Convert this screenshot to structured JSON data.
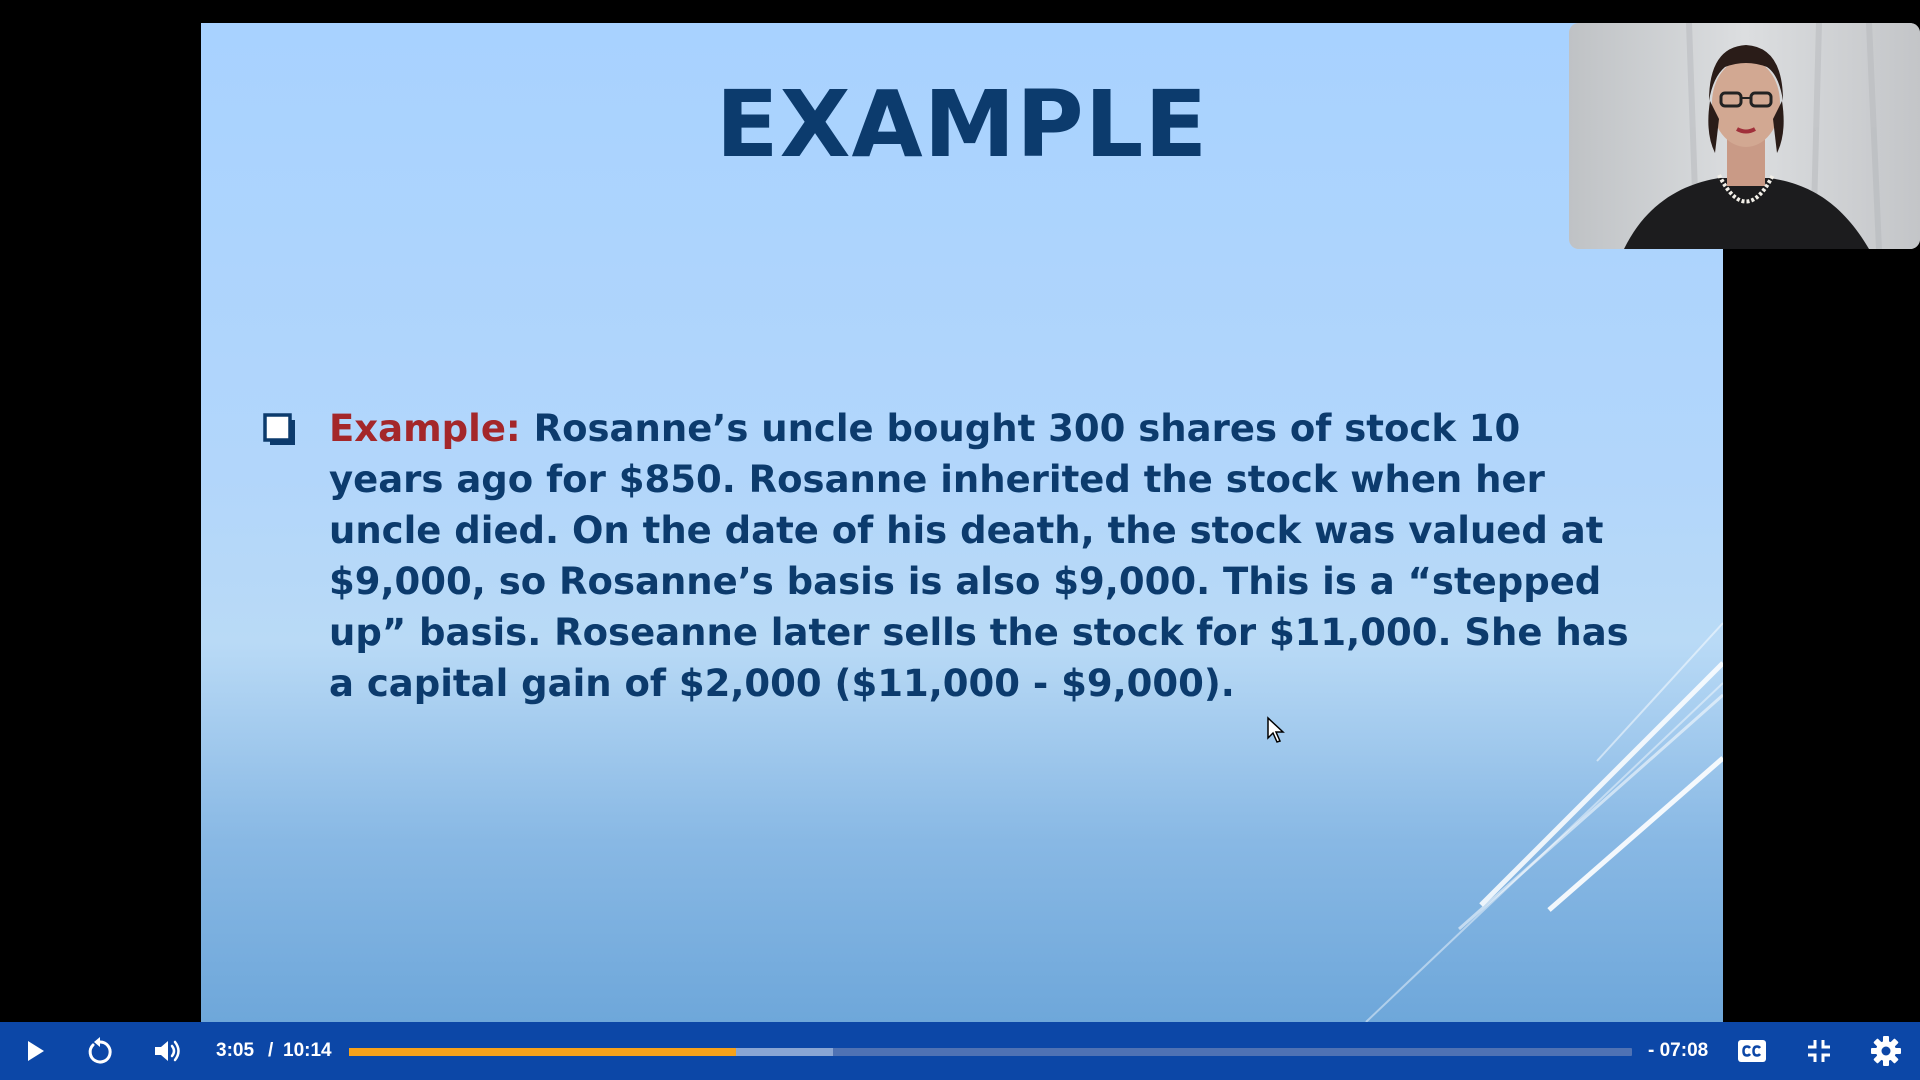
{
  "slide": {
    "title": "EXAMPLE",
    "bullet": {
      "lead": "Example:",
      "text": " Rosanne’s uncle bought 300 shares of stock 10 years ago for $850. Rosanne inherited the stock when her uncle died. On the date of his death, the stock was valued at $9,000, so Rosanne’s basis is also $9,000. This is a “stepped up” basis. Roseanne later sells the stock for $11,000. She has a capital gain of $2,000 ($11,000 - $9,000)."
    }
  },
  "player": {
    "time_current": "3:05",
    "time_separator": "/",
    "time_total": "10:14",
    "time_remaining": "- 07:08",
    "progress_fraction": 0.3014,
    "buffered_fraction": 0.3775,
    "icons": {
      "play": "play-icon",
      "replay": "replay-icon",
      "volume": "volume-icon",
      "captions": "closed-captions-icon",
      "exit_fullscreen": "exit-fullscreen-icon",
      "settings": "gear-icon"
    }
  },
  "colors": {
    "title": "#0c3b6d",
    "body_text": "#0c3b6d",
    "lead": "#a4272a",
    "control_bar": "#0c47a7",
    "progress_played": "#f7a21b",
    "progress_buffered": "#8aa6d4",
    "progress_track": "#4f72b4"
  }
}
